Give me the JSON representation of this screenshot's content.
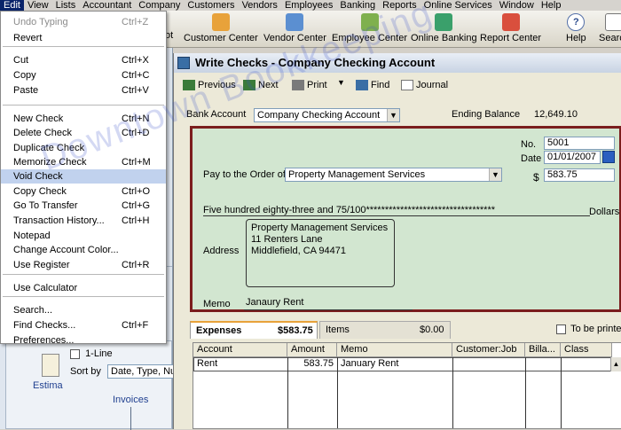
{
  "menubar": [
    "Edit",
    "View",
    "Lists",
    "Accountant",
    "Company",
    "Customers",
    "Vendors",
    "Employees",
    "Banking",
    "Reports",
    "Online Services",
    "Window",
    "Help"
  ],
  "toolbar": {
    "partial": "ot",
    "customer_center": "Customer Center",
    "vendor_center": "Vendor Center",
    "employee_center": "Employee Center",
    "online_banking": "Online Banking",
    "report_center": "Report Center",
    "help": "Help",
    "search": "Search"
  },
  "edit_menu": [
    {
      "label": "Undo Typing",
      "shortcut": "Ctrl+Z",
      "disabled": true
    },
    {
      "label": "Revert",
      "shortcut": ""
    },
    {
      "label": "Cut",
      "shortcut": "Ctrl+X"
    },
    {
      "label": "Copy",
      "shortcut": "Ctrl+C"
    },
    {
      "label": "Paste",
      "shortcut": "Ctrl+V"
    },
    {
      "label": "New Check",
      "shortcut": "Ctrl+N"
    },
    {
      "label": "Delete Check",
      "shortcut": "Ctrl+D"
    },
    {
      "label": "Duplicate Check",
      "shortcut": ""
    },
    {
      "label": "Memorize Check",
      "shortcut": "Ctrl+M"
    },
    {
      "label": "Void Check",
      "shortcut": "",
      "highlighted": true
    },
    {
      "label": "Copy Check",
      "shortcut": "Ctrl+O"
    },
    {
      "label": "Go To Transfer",
      "shortcut": "Ctrl+G"
    },
    {
      "label": "Transaction History...",
      "shortcut": "Ctrl+H"
    },
    {
      "label": "Notepad",
      "shortcut": ""
    },
    {
      "label": "Change Account Color...",
      "shortcut": ""
    },
    {
      "label": "Use Register",
      "shortcut": "Ctrl+R"
    },
    {
      "label": "Use Calculator",
      "shortcut": ""
    },
    {
      "label": "Search...",
      "shortcut": ""
    },
    {
      "label": "Find Checks...",
      "shortcut": "Ctrl+F"
    },
    {
      "label": "Preferences...",
      "shortcut": ""
    }
  ],
  "left": {
    "one_line": "1-Line",
    "sort_by": "Sort by",
    "sort_value": "Date, Type, Nu",
    "estimates": "Estima",
    "invoices": "Invoices"
  },
  "window": {
    "title": "Write Checks - Company Checking Account",
    "previous": "Previous",
    "next": "Next",
    "print": "Print",
    "find": "Find",
    "journal": "Journal",
    "bank_account_label": "Bank Account",
    "bank_account": "Company Checking Account",
    "ending_balance_label": "Ending Balance",
    "ending_balance": "12,649.10"
  },
  "check": {
    "no_label": "No.",
    "number": "5001",
    "date_label": "Date",
    "date": "01/01/2007",
    "pay_to_label": "Pay to the Order of",
    "payee": "Property Management Services",
    "dollar_sign": "$",
    "amount": "583.75",
    "amount_words": "Five hundred eighty-three and 75/100**********************************",
    "dollars_label": "Dollars",
    "address_label": "Address",
    "address_line1": "Property Management Services",
    "address_line2": "11 Renters Lane",
    "address_line3": "Middlefield, CA 94471",
    "memo_label": "Memo",
    "memo": "Janaury Rent"
  },
  "tabs": {
    "expenses": "Expenses",
    "expenses_amount": "$583.75",
    "items": "Items",
    "items_amount": "$0.00",
    "to_be_printed": "To be printed"
  },
  "grid": {
    "columns": [
      "Account",
      "Amount",
      "Memo",
      "Customer:Job",
      "Billa...",
      "Class"
    ],
    "rows": [
      [
        "Rent",
        "583.75",
        "January Rent",
        "",
        "",
        ""
      ]
    ]
  },
  "watermark": "Downtown Bookkeeping"
}
